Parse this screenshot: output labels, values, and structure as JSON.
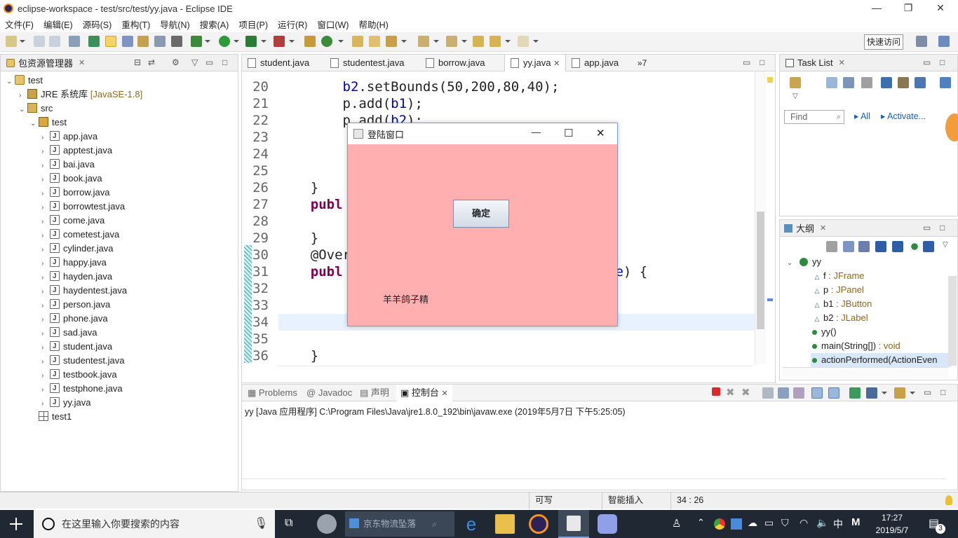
{
  "window": {
    "title": "eclipse-workspace - test/src/test/yy.java - Eclipse IDE",
    "min": "—",
    "max": "❐",
    "close": "✕"
  },
  "menu": [
    "文件(F)",
    "编辑(E)",
    "源码(S)",
    "重构(T)",
    "导航(N)",
    "搜索(A)",
    "项目(P)",
    "运行(R)",
    "窗口(W)",
    "帮助(H)"
  ],
  "toolbar": {
    "quick_access": "快速访问"
  },
  "explorer": {
    "title": "包资源管理器",
    "close": "✕",
    "project": "test",
    "jre": "JRE 系统库",
    "jre_version": "[JavaSE-1.8]",
    "src": "src",
    "package": "test",
    "files": [
      "app.java",
      "apptest.java",
      "bai.java",
      "book.java",
      "borrow.java",
      "borrowtest.java",
      "come.java",
      "cometest.java",
      "cylinder.java",
      "happy.java",
      "hayden.java",
      "haydentest.java",
      "person.java",
      "phone.java",
      "sad.java",
      "student.java",
      "studentest.java",
      "testbook.java",
      "testphone.java",
      "yy.java"
    ],
    "other_project": "test1"
  },
  "editor": {
    "tabs": [
      {
        "label": "student.java"
      },
      {
        "label": "studentest.java"
      },
      {
        "label": "borrow.java"
      },
      {
        "label": "yy.java",
        "close": "✕"
      },
      {
        "label": "app.java"
      },
      {
        "label": "»7"
      }
    ],
    "lines": [
      {
        "n": "20",
        "text": "        b2.setBounds(50,200,80,40);"
      },
      {
        "n": "21",
        "text": "        p.add(b1);"
      },
      {
        "n": "22",
        "text": "        p.add(b2);"
      },
      {
        "n": "23",
        "text": "        "
      },
      {
        "n": "24",
        "text": "        "
      },
      {
        "n": "25",
        "text": "        "
      },
      {
        "n": "26",
        "text": "    }"
      },
      {
        "n": "27",
        "text": "    publ                              ) {"
      },
      {
        "n": "28",
        "text": "        "
      },
      {
        "n": "29",
        "text": "    }"
      },
      {
        "n": "30",
        "text": "    @Over"
      },
      {
        "n": "31",
        "text": "    publ                              ent e) {"
      },
      {
        "n": "32",
        "text": "        "
      },
      {
        "n": "33",
        "text": "        "
      },
      {
        "n": "34",
        "text": "        "
      },
      {
        "n": "35",
        "text": ""
      },
      {
        "n": "36",
        "text": "    }"
      }
    ]
  },
  "dialog": {
    "title": "登陆窗口",
    "min": "—",
    "max": "☐",
    "close": "✕",
    "button": "确定",
    "label": "羊羊鸽子精"
  },
  "tasklist": {
    "title": "Task List",
    "close": "✕",
    "find_placeholder": "Find",
    "all": "All",
    "activate": "Activate..."
  },
  "outline": {
    "title": "大纲",
    "close": "✕",
    "class": "yy",
    "members": [
      {
        "name": "f",
        "type": " : JFrame"
      },
      {
        "name": "p",
        "type": " : JPanel"
      },
      {
        "name": "b1",
        "type": " : JButton"
      },
      {
        "name": "b2",
        "type": " : JLabel"
      },
      {
        "name": "yy()",
        "type": ""
      },
      {
        "name": "main(String[])",
        "type": " : void"
      },
      {
        "name": "actionPerformed(ActionEven",
        "type": ""
      }
    ]
  },
  "console": {
    "tabs": [
      "Problems",
      "Javadoc",
      "声明",
      "控制台"
    ],
    "close": "✕",
    "text": "yy [Java 应用程序] C:\\Program Files\\Java\\jre1.8.0_192\\bin\\javaw.exe  (2019年5月7日 下午5:25:05)"
  },
  "status": {
    "writable": "可写",
    "insert": "智能插入",
    "position": "34 : 26"
  },
  "taskbar": {
    "search": "在这里输入你要搜索的内容",
    "app_label": "京东物流坠落",
    "time": "17:27",
    "date": "2019/5/7",
    "ime": "中",
    "ime2": "M",
    "notif": "3"
  },
  "colors": {
    "dialog_bg": "#ffafaf",
    "keyword": "#7f0055",
    "variable": "#0000c0",
    "taskbar": "#1f2833"
  }
}
